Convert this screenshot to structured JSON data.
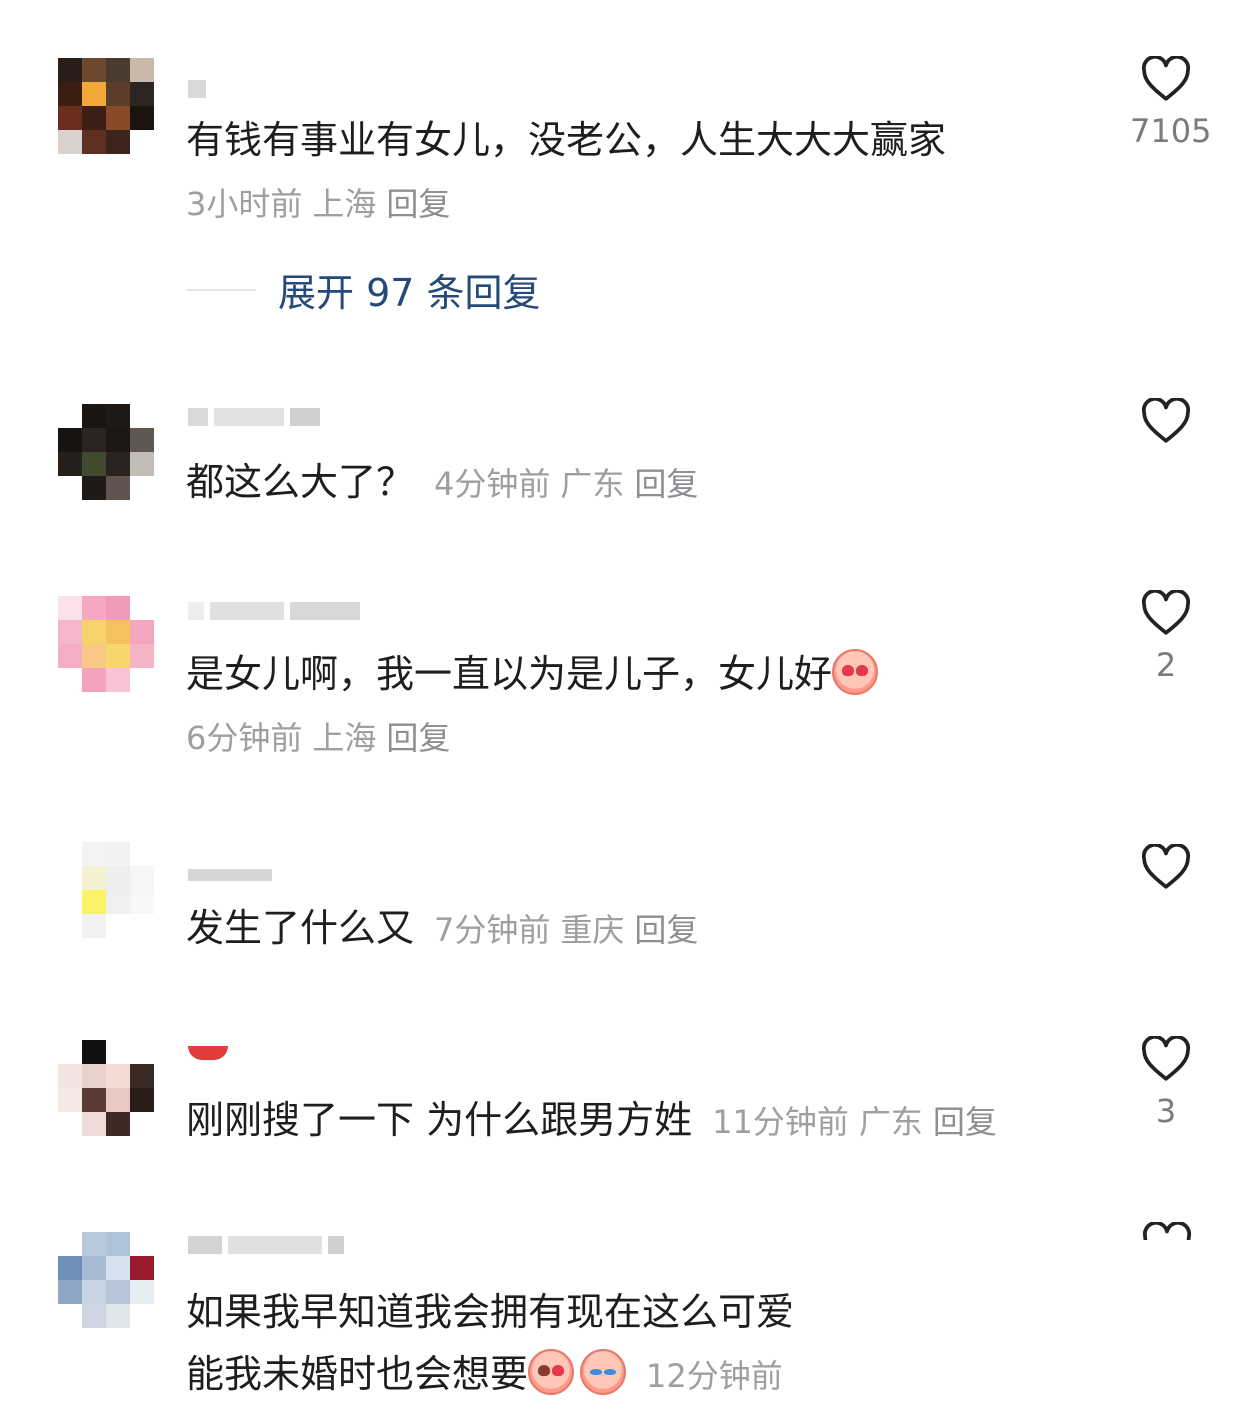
{
  "comments": [
    {
      "text": "有钱有事业有女儿，没老公，人生大大大赢家",
      "time": "3小时前",
      "location": "上海",
      "reply_label": "回复",
      "likes": "7105",
      "expand_label": "展开 97 条回复"
    },
    {
      "text": "都这么大了？",
      "time": "4分钟前",
      "location": "广东",
      "reply_label": "回复",
      "likes": ""
    },
    {
      "text": "是女儿啊，我一直以为是儿子，女儿好",
      "time": "6分钟前",
      "location": "上海",
      "reply_label": "回复",
      "likes": "2"
    },
    {
      "text": "发生了什么又",
      "time": "7分钟前",
      "location": "重庆",
      "reply_label": "回复",
      "likes": ""
    },
    {
      "text": "刚刚搜了一下 为什么跟男方姓",
      "time": "11分钟前",
      "location": "广东",
      "reply_label": "回复",
      "likes": "3"
    },
    {
      "text_line1": "如果我早知道我会拥有现在这么可爱",
      "text_line2": "能我未婚时也会想要",
      "time": "12分钟前"
    }
  ],
  "icons": {
    "like": "heart-outline-icon",
    "emoji_heart_eyes": "heart-eyes-emoji-icon",
    "emoji_shy": "shy-cover-mouth-emoji-icon",
    "emoji_cry_laugh": "crying-laughing-emoji-icon"
  },
  "colors": {
    "expand_link": "#234a78",
    "meta_gray": "#9e9ea3",
    "text": "#1e1e1e"
  }
}
